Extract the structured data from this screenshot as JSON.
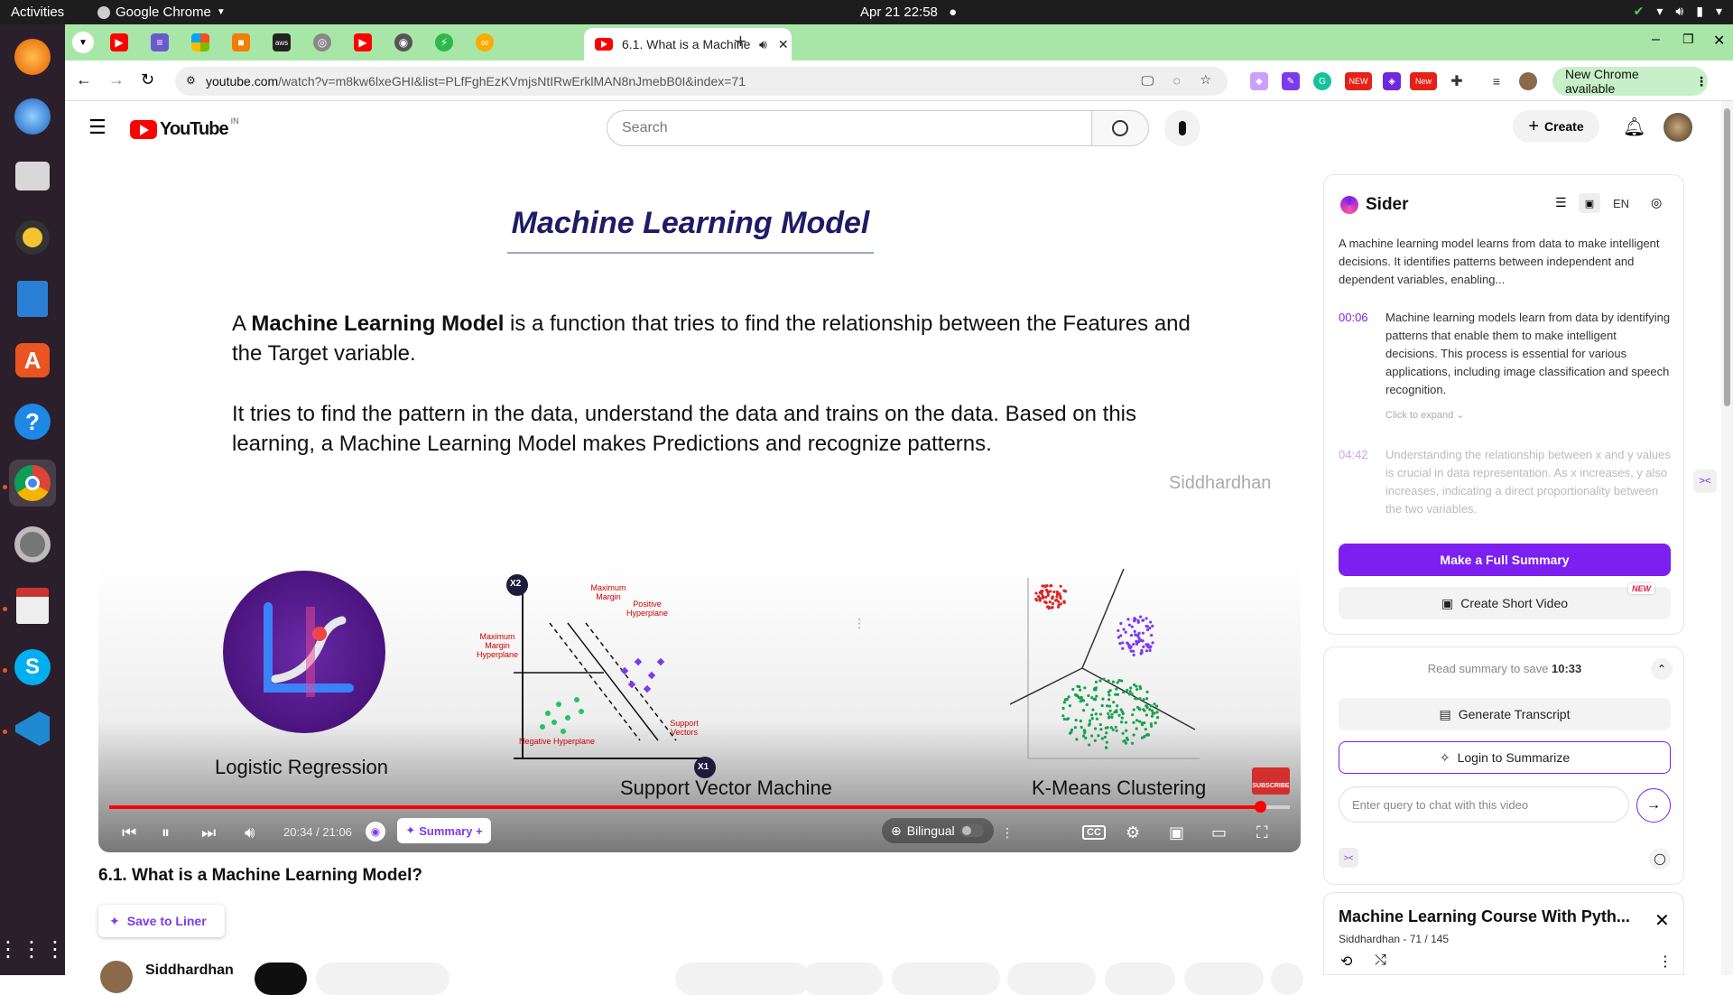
{
  "system": {
    "activities": "Activities",
    "app_name": "Google Chrome",
    "clock": "Apr 21  22:58"
  },
  "browser": {
    "active_tab_title": "6.1. What is a Machine",
    "url_host": "youtube.com",
    "url_rest": "/watch?v=m8kw6lxeGHI&list=PLfFghEzKVmjsNtIRwErklMAN8nJmebB0I&index=71",
    "new_chrome_label": "New Chrome available",
    "ext_badge_1": "NEW",
    "ext_badge_2": "New"
  },
  "youtube": {
    "logo_word": "YouTube",
    "region": "IN",
    "search_placeholder": "Search",
    "create_label": "Create"
  },
  "slide": {
    "title": "Machine Learning Model",
    "para1_prefix": "A ",
    "para1_bold": "Machine Learning Model",
    "para1_rest": " is a function that tries to find the relationship between the Features and the Target variable.",
    "para2": "It tries to find the pattern in the data, understand the data and trains on the data. Based on this learning, a Machine Learning Model makes Predictions and recognize patterns.",
    "watermark": "Siddhardhan",
    "caption_lr": "Logistic Regression",
    "caption_svm": "Support Vector Machine",
    "caption_km": "K-Means Clustering",
    "svm_labels": {
      "x2": "X2",
      "x1": "X1",
      "max_margin": "Maximum Margin",
      "positive": "Positive Hyperplane",
      "max_margin_hp": "Maximum Margin Hyperplane",
      "negative": "Negative Hyperplane",
      "support": "Support Vectors"
    },
    "subscribe": "SUBSCRIBE"
  },
  "player": {
    "time": "20:34 / 21:06",
    "progress": 0.975,
    "summary_label": "Summary +",
    "bilingual_label": "Bilingual",
    "cc_label": "CC"
  },
  "video": {
    "title": "6.1. What is a Machine Learning Model?",
    "save_to_liner": "Save to Liner",
    "channel": "Siddhardhan"
  },
  "sider": {
    "brand": "Sider",
    "lang": "EN",
    "summary_intro": "A machine learning model learns from data to make intelligent decisions. It identifies patterns between independent and dependent variables, enabling...",
    "item1_time": "00:06",
    "item1_text": "Machine learning models learn from data by identifying patterns that enable them to make intelligent decisions. This process is essential for various applications, including image classification and speech recognition.",
    "click_expand": "Click to expand",
    "item2_time": "04:42",
    "item2_text": "Understanding the relationship between x and y values is crucial in data representation. As x increases, y also increases, indicating a direct proportionality between the two variables.",
    "full_summary_btn": "Make a Full Summary",
    "short_video_btn": "Create Short Video",
    "new_badge": "NEW",
    "read_summary_prefix": "Read summary to save ",
    "read_summary_time": "10:33",
    "transcript_btn": "Generate Transcript",
    "login_btn": "Login to Summarize",
    "chat_placeholder": "Enter query to chat with this video"
  },
  "playlist": {
    "title": "Machine Learning Course With Pyth...",
    "channel": "Siddhardhan",
    "position": "71 / 145"
  },
  "colors": {
    "chrome_tabstrip": "#a8e6a8",
    "sider_purple": "#7c1ff0",
    "youtube_red": "#ff0000"
  }
}
